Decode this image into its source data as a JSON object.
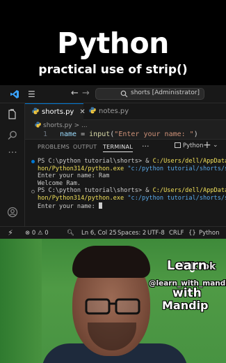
{
  "banner": {
    "title": "Python",
    "subtitle": "practical use of strip()"
  },
  "vscode": {
    "command_center": "shorts [Administrator]",
    "tabs": [
      {
        "label": "shorts.py",
        "active": true
      },
      {
        "label": "notes.py",
        "active": false
      }
    ],
    "breadcrumb": "shorts.py > ...",
    "code": {
      "line_number": "1",
      "var": "name",
      "op": " = ",
      "fn": "input",
      "open": "(",
      "str": "\"Enter your name: \"",
      "close": ")"
    },
    "panel_tabs": [
      "PROBLEMS",
      "OUTPUT",
      "TERMINAL"
    ],
    "panel_more": "···",
    "terminal_selector": "Python",
    "terminal": {
      "l1_prompt": "PS C:\\python tutorial\\shorts> & ",
      "l1_path": "C:/Users/dell/AppData/",
      "l2_path": "hon/Python314/python.exe",
      "l2_arg": " \"c:/python tutorial/shorts/sh",
      "l3": "Enter your name: Ram",
      "l4": "Welcome Ram.",
      "l5_prompt": "PS C:\\python tutorial\\shorts> & ",
      "l5_path": "C:/Users/dell/AppData/",
      "l6_path": "hon/Python314/python.exe",
      "l6_arg": " \"c:/python tutorial/shorts/sh",
      "l7": "Enter your name: "
    },
    "status": {
      "errors": "0",
      "warnings": "0",
      "position": "Ln 6, Col 25",
      "spaces": "Spaces: 2",
      "encoding": "UTF-8",
      "eol": "CRLF",
      "braces": "{}",
      "language": "Python"
    }
  },
  "watermark": {
    "tiktok": "TikTok",
    "handle": "@learn_with_mandip",
    "line1": "Learn",
    "line2": "with",
    "line3": "Mandip"
  },
  "colors": {
    "vscode_blue": "#0078d4",
    "terminal_yellow": "#f1e05a",
    "terminal_string": "#59a8e8"
  }
}
